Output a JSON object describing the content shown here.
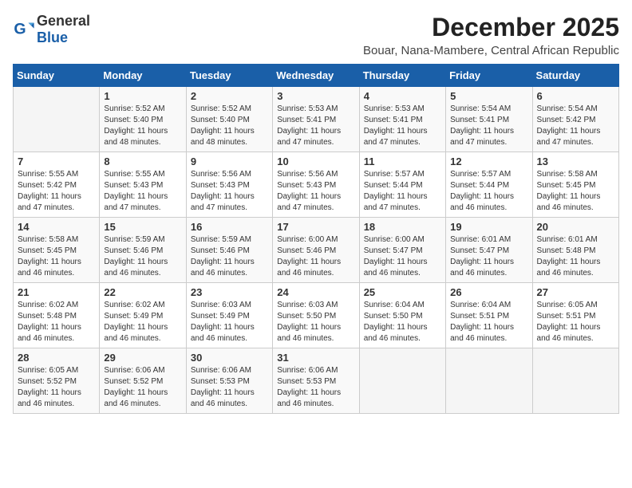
{
  "logo": {
    "general": "General",
    "blue": "Blue"
  },
  "title": "December 2025",
  "subtitle": "Bouar, Nana-Mambere, Central African Republic",
  "weekdays": [
    "Sunday",
    "Monday",
    "Tuesday",
    "Wednesday",
    "Thursday",
    "Friday",
    "Saturday"
  ],
  "weeks": [
    [
      {
        "day": "",
        "info": ""
      },
      {
        "day": "1",
        "info": "Sunrise: 5:52 AM\nSunset: 5:40 PM\nDaylight: 11 hours\nand 48 minutes."
      },
      {
        "day": "2",
        "info": "Sunrise: 5:52 AM\nSunset: 5:40 PM\nDaylight: 11 hours\nand 48 minutes."
      },
      {
        "day": "3",
        "info": "Sunrise: 5:53 AM\nSunset: 5:41 PM\nDaylight: 11 hours\nand 47 minutes."
      },
      {
        "day": "4",
        "info": "Sunrise: 5:53 AM\nSunset: 5:41 PM\nDaylight: 11 hours\nand 47 minutes."
      },
      {
        "day": "5",
        "info": "Sunrise: 5:54 AM\nSunset: 5:41 PM\nDaylight: 11 hours\nand 47 minutes."
      },
      {
        "day": "6",
        "info": "Sunrise: 5:54 AM\nSunset: 5:42 PM\nDaylight: 11 hours\nand 47 minutes."
      }
    ],
    [
      {
        "day": "7",
        "info": "Sunrise: 5:55 AM\nSunset: 5:42 PM\nDaylight: 11 hours\nand 47 minutes."
      },
      {
        "day": "8",
        "info": "Sunrise: 5:55 AM\nSunset: 5:43 PM\nDaylight: 11 hours\nand 47 minutes."
      },
      {
        "day": "9",
        "info": "Sunrise: 5:56 AM\nSunset: 5:43 PM\nDaylight: 11 hours\nand 47 minutes."
      },
      {
        "day": "10",
        "info": "Sunrise: 5:56 AM\nSunset: 5:43 PM\nDaylight: 11 hours\nand 47 minutes."
      },
      {
        "day": "11",
        "info": "Sunrise: 5:57 AM\nSunset: 5:44 PM\nDaylight: 11 hours\nand 47 minutes."
      },
      {
        "day": "12",
        "info": "Sunrise: 5:57 AM\nSunset: 5:44 PM\nDaylight: 11 hours\nand 46 minutes."
      },
      {
        "day": "13",
        "info": "Sunrise: 5:58 AM\nSunset: 5:45 PM\nDaylight: 11 hours\nand 46 minutes."
      }
    ],
    [
      {
        "day": "14",
        "info": "Sunrise: 5:58 AM\nSunset: 5:45 PM\nDaylight: 11 hours\nand 46 minutes."
      },
      {
        "day": "15",
        "info": "Sunrise: 5:59 AM\nSunset: 5:46 PM\nDaylight: 11 hours\nand 46 minutes."
      },
      {
        "day": "16",
        "info": "Sunrise: 5:59 AM\nSunset: 5:46 PM\nDaylight: 11 hours\nand 46 minutes."
      },
      {
        "day": "17",
        "info": "Sunrise: 6:00 AM\nSunset: 5:46 PM\nDaylight: 11 hours\nand 46 minutes."
      },
      {
        "day": "18",
        "info": "Sunrise: 6:00 AM\nSunset: 5:47 PM\nDaylight: 11 hours\nand 46 minutes."
      },
      {
        "day": "19",
        "info": "Sunrise: 6:01 AM\nSunset: 5:47 PM\nDaylight: 11 hours\nand 46 minutes."
      },
      {
        "day": "20",
        "info": "Sunrise: 6:01 AM\nSunset: 5:48 PM\nDaylight: 11 hours\nand 46 minutes."
      }
    ],
    [
      {
        "day": "21",
        "info": "Sunrise: 6:02 AM\nSunset: 5:48 PM\nDaylight: 11 hours\nand 46 minutes."
      },
      {
        "day": "22",
        "info": "Sunrise: 6:02 AM\nSunset: 5:49 PM\nDaylight: 11 hours\nand 46 minutes."
      },
      {
        "day": "23",
        "info": "Sunrise: 6:03 AM\nSunset: 5:49 PM\nDaylight: 11 hours\nand 46 minutes."
      },
      {
        "day": "24",
        "info": "Sunrise: 6:03 AM\nSunset: 5:50 PM\nDaylight: 11 hours\nand 46 minutes."
      },
      {
        "day": "25",
        "info": "Sunrise: 6:04 AM\nSunset: 5:50 PM\nDaylight: 11 hours\nand 46 minutes."
      },
      {
        "day": "26",
        "info": "Sunrise: 6:04 AM\nSunset: 5:51 PM\nDaylight: 11 hours\nand 46 minutes."
      },
      {
        "day": "27",
        "info": "Sunrise: 6:05 AM\nSunset: 5:51 PM\nDaylight: 11 hours\nand 46 minutes."
      }
    ],
    [
      {
        "day": "28",
        "info": "Sunrise: 6:05 AM\nSunset: 5:52 PM\nDaylight: 11 hours\nand 46 minutes."
      },
      {
        "day": "29",
        "info": "Sunrise: 6:06 AM\nSunset: 5:52 PM\nDaylight: 11 hours\nand 46 minutes."
      },
      {
        "day": "30",
        "info": "Sunrise: 6:06 AM\nSunset: 5:53 PM\nDaylight: 11 hours\nand 46 minutes."
      },
      {
        "day": "31",
        "info": "Sunrise: 6:06 AM\nSunset: 5:53 PM\nDaylight: 11 hours\nand 46 minutes."
      },
      {
        "day": "",
        "info": ""
      },
      {
        "day": "",
        "info": ""
      },
      {
        "day": "",
        "info": ""
      }
    ]
  ]
}
